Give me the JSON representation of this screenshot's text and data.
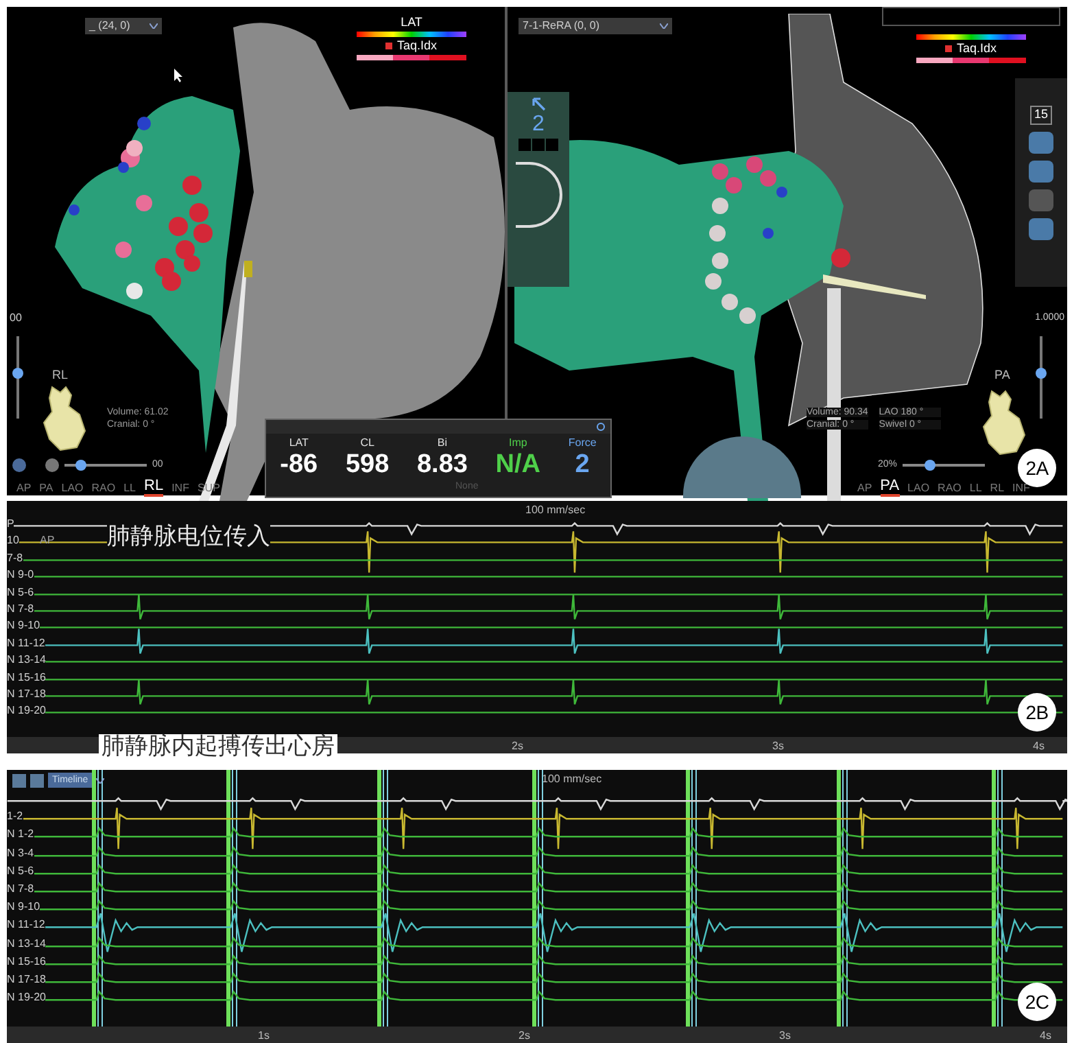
{
  "figure_2a": {
    "label": "2A",
    "left_view": {
      "dropdown": "_ (24, 0)",
      "legend": {
        "title": "LAT",
        "index_label": "Taq.Idx"
      },
      "scale": "00",
      "orientation": "RL",
      "stats": [
        {
          "label": "Volume:",
          "value": "61.02"
        },
        {
          "label": "Cranial:",
          "value": "0 °"
        }
      ],
      "slider_value": "00",
      "vertical_slider": {
        "level": 0.55
      },
      "zoom_slider": {
        "level": 0.15
      },
      "view_tabs": [
        {
          "label": "AP",
          "selected": false
        },
        {
          "label": "PA",
          "selected": false
        },
        {
          "label": "LAO",
          "selected": false
        },
        {
          "label": "RAO",
          "selected": false
        },
        {
          "label": "LL",
          "selected": false
        },
        {
          "label": "RL",
          "selected": true
        },
        {
          "label": "INF",
          "selected": false
        },
        {
          "label": "SUP",
          "selected": false
        }
      ]
    },
    "right_view": {
      "dropdown": "7-1-ReRA (0, 0)",
      "legend": {
        "index_label": "Taq.Idx"
      },
      "contact_force": "2",
      "toolbar_value": "15",
      "scale": "1.0000",
      "orientation": "PA",
      "stats": [
        {
          "label": "Volume:",
          "value": "90.34"
        },
        {
          "label": "LAO",
          "value": "180 °"
        },
        {
          "label": "Cranial:",
          "value": "0 °"
        },
        {
          "label": "Swivel",
          "value": "0 °"
        }
      ],
      "zoom": "20%",
      "vertical_slider": {
        "level": 0.55
      },
      "zoom_slider": {
        "level": 0.3
      },
      "view_tabs": [
        {
          "label": "AP",
          "selected": false
        },
        {
          "label": "PA",
          "selected": true
        },
        {
          "label": "LAO",
          "selected": false
        },
        {
          "label": "RAO",
          "selected": false
        },
        {
          "label": "LL",
          "selected": false
        },
        {
          "label": "RL",
          "selected": false
        },
        {
          "label": "INF",
          "selected": false
        }
      ]
    },
    "readout": {
      "dropdown": "None",
      "metrics": [
        {
          "label": "LAT",
          "value": "-86",
          "color": "#ffffff"
        },
        {
          "label": "CL",
          "value": "598",
          "color": "#ffffff"
        },
        {
          "label": "Bi",
          "value": "8.83",
          "color": "#ffffff"
        },
        {
          "label": "Imp",
          "value": "N/A",
          "color": "#4fd04a"
        },
        {
          "label": "Force",
          "value": "2",
          "color": "#6aa6f0"
        }
      ]
    }
  },
  "figure_2b": {
    "label": "2B",
    "caption": "肺静脉电位传入",
    "speed": "100 mm/sec",
    "time_ticks": [
      "2s",
      "3s",
      "4s"
    ],
    "channels": [
      {
        "label": "P",
        "kind": "surface",
        "color": "#d8d8d8"
      },
      {
        "label": "10",
        "sublabel": "AP",
        "kind": "stim",
        "color": "#c8b830"
      },
      {
        "label": "7-8",
        "kind": "flat",
        "color": "#3fb83a"
      },
      {
        "label": "N 9-0",
        "kind": "flat",
        "color": "#3fb83a"
      },
      {
        "label": "N 5-6",
        "kind": "flat",
        "color": "#3fb83a"
      },
      {
        "label": "N 7-8",
        "kind": "spike",
        "color": "#3fb83a"
      },
      {
        "label": "N 9-10",
        "kind": "flat",
        "color": "#3fb83a"
      },
      {
        "label": "N 11-12",
        "kind": "spike",
        "color": "#4cc0c0"
      },
      {
        "label": "N 13-14",
        "kind": "flat",
        "color": "#3fb83a"
      },
      {
        "label": "N 15-16",
        "kind": "flat",
        "color": "#3fb83a"
      },
      {
        "label": "N 17-18",
        "kind": "spike",
        "color": "#3fb83a"
      },
      {
        "label": "N 19-20",
        "kind": "flat",
        "color": "#3fb83a"
      }
    ]
  },
  "caption_between": "肺静脉内起搏传出心房",
  "figure_2c": {
    "label": "2C",
    "toolbar_dropdown": "Timeline",
    "speed": "100 mm/sec",
    "time_ticks": [
      "1s",
      "2s",
      "3s",
      "4s"
    ],
    "channels": [
      {
        "kind": "surface",
        "color": "#d8d8d8"
      },
      {
        "label": "1-2",
        "kind": "stim",
        "color": "#c8b830"
      },
      {
        "label": "N 1-2",
        "kind": "far",
        "color": "#3fb83a"
      },
      {
        "label": "N 3-4",
        "kind": "far",
        "color": "#3fb83a"
      },
      {
        "label": "N 5-6",
        "kind": "far",
        "color": "#3fb83a"
      },
      {
        "label": "N 7-8",
        "kind": "far",
        "color": "#3fb83a"
      },
      {
        "label": "N 9-10",
        "kind": "far",
        "color": "#3fb83a"
      },
      {
        "label": "N 11-12",
        "kind": "ring",
        "color": "#4cc0c0"
      },
      {
        "label": "N 13-14",
        "kind": "far",
        "color": "#3fb83a"
      },
      {
        "label": "N 15-16",
        "kind": "far",
        "color": "#3fb83a"
      },
      {
        "label": "N 17-18",
        "kind": "far",
        "color": "#3fb83a"
      },
      {
        "label": "N 19-20",
        "kind": "far",
        "color": "#3fb83a"
      }
    ]
  }
}
